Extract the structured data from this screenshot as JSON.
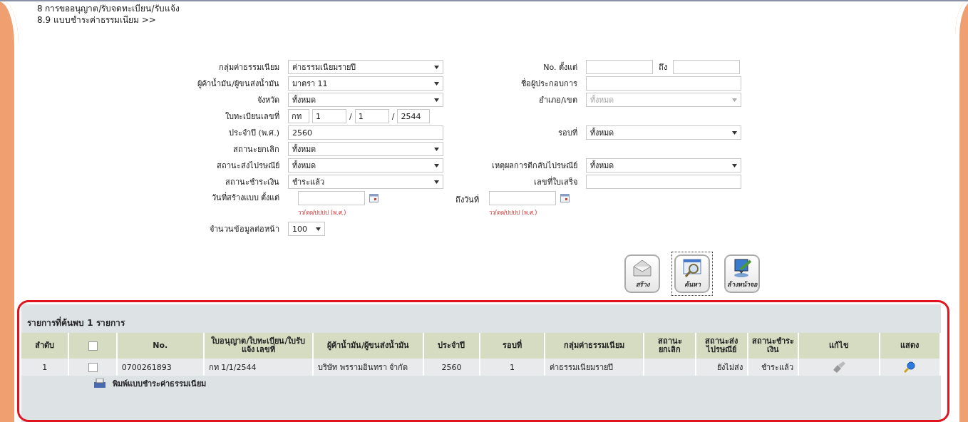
{
  "breadcrumb": [
    "8 การขออนุญาต/รับจดทะเบียน/รับแจ้ง",
    "8.9 แบบชำระค่าธรรมเนียม >>"
  ],
  "form": {
    "rows": [
      {
        "left": {
          "label": "กลุ่มค่าธรรมเนียม",
          "field": {
            "kind": "select",
            "value": "ค่าธรรมเนียมรายปี",
            "disabled": false
          }
        },
        "right": {
          "label": "No. ตั้งแต่",
          "field": {
            "kind": "range",
            "between": "ถึง"
          }
        }
      },
      {
        "left": {
          "label": "ผู้ค้าน้ำมัน/ผู้ขนส่งน้ำมัน",
          "field": {
            "kind": "select",
            "value": "มาตรา 11",
            "disabled": false
          }
        },
        "right": {
          "label": "ชื่อผู้ประกอบการ",
          "field": {
            "kind": "text"
          }
        }
      },
      {
        "left": {
          "label": "จังหวัด",
          "field": {
            "kind": "select",
            "value": "ทั้งหมด",
            "disabled": false
          }
        },
        "right": {
          "label": "อำเภอ/เขต",
          "field": {
            "kind": "select",
            "value": "ทั้งหมด",
            "disabled": true
          }
        }
      },
      {
        "left": {
          "label": "ใบทะเบียนเลขที่",
          "field": {
            "kind": "license",
            "parts": [
              "กท",
              "1",
              "1",
              "2544"
            ],
            "separator": "/"
          }
        }
      },
      {
        "left": {
          "label": "ประจำปี (พ.ศ.)",
          "field": {
            "kind": "text",
            "value": "2560"
          }
        },
        "right": {
          "label": "รอบที่",
          "field": {
            "kind": "select",
            "value": "ทั้งหมด",
            "disabled": false
          }
        }
      },
      {
        "left": {
          "label": "สถานะยกเลิก",
          "field": {
            "kind": "select",
            "value": "ทั้งหมด",
            "disabled": false
          }
        }
      },
      {
        "left": {
          "label": "สถานะส่งไปรษณีย์",
          "field": {
            "kind": "select",
            "value": "ทั้งหมด",
            "disabled": false
          }
        },
        "right": {
          "label": "เหตุผลการตีกลับไปรษณีย์",
          "field": {
            "kind": "select",
            "value": "ทั้งหมด",
            "disabled": false
          }
        }
      },
      {
        "left": {
          "label": "สถานะชำระเงิน",
          "field": {
            "kind": "select",
            "value": "ชำระแล้ว",
            "disabled": false
          }
        },
        "right": {
          "label": "เลขที่ใบเสร็จ",
          "field": {
            "kind": "text"
          }
        }
      }
    ],
    "date_row": {
      "from_label": "วันที่สร้างแบบ ตั้งแต่",
      "from_hint": "วว/ดด/ปปปป (พ.ศ.)",
      "to_label": "ถึงวันที่",
      "to_hint": "วว/ดด/ปปปป (พ.ศ.)"
    },
    "per_page": {
      "label": "จำนวนข้อมูลต่อหน้า",
      "value": "100"
    }
  },
  "buttons": [
    {
      "kind": "create",
      "label": "สร้าง",
      "focused": false
    },
    {
      "kind": "search",
      "label": "ค้นหา",
      "focused": true
    },
    {
      "kind": "clear",
      "label": "ล้างหน้าจอ",
      "focused": false
    }
  ],
  "results": {
    "title": "รายการที่ค้นพบ 1 รายการ",
    "columns": [
      {
        "kind": "text",
        "label": "ลำดับ"
      },
      {
        "kind": "checkbox",
        "checked": false
      },
      {
        "kind": "text",
        "label": "No."
      },
      {
        "kind": "text",
        "label": "ใบอนุญาต/ใบทะเบียน/ใบรับแจ้ง เลขที่"
      },
      {
        "kind": "text",
        "label": "ผู้ค้าน้ำมัน/ผู้ขนส่งน้ำมัน"
      },
      {
        "kind": "text",
        "label": "ประจำปี"
      },
      {
        "kind": "text",
        "label": "รอบที่"
      },
      {
        "kind": "text",
        "label": "กลุ่มค่าธรรมเนียม"
      },
      {
        "kind": "text",
        "label": "สถานะยกเลิก"
      },
      {
        "kind": "text",
        "label": "สถานะส่งไปรษณีย์"
      },
      {
        "kind": "text",
        "label": "สถานะชำระเงิน"
      },
      {
        "kind": "text",
        "label": "แก้ไข"
      },
      {
        "kind": "text",
        "label": "แสดง"
      }
    ],
    "rows": [
      {
        "index": "1",
        "checked": false,
        "no": "0700261893",
        "license": "กท 1/1/2544",
        "operator": "บริษัท พรรามอินทรา จำกัด",
        "year": "2560",
        "round": "1",
        "group": "ค่าธรรมเนียมรายปี",
        "post_status": "ยังไม่ส่ง",
        "pay_status": "ชำระแล้ว"
      }
    ],
    "print_link": "พิมพ์แบบชำระค่าธรรมเนียม"
  }
}
